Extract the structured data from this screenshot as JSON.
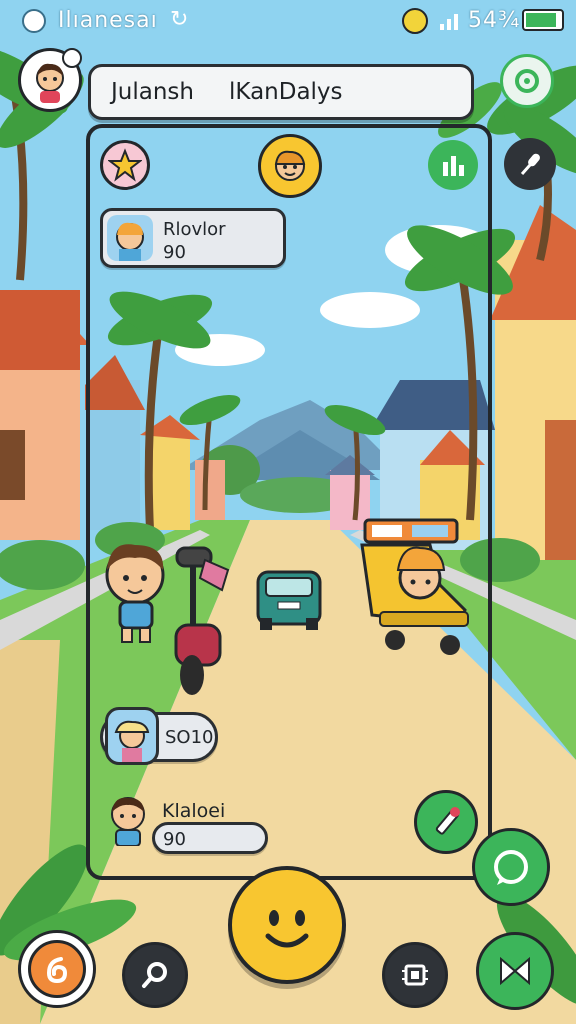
{
  "status_bar": {
    "carrier": "Ilıanesaı",
    "battery_text": "54¾"
  },
  "search_bar": {
    "left_text": "Julansh",
    "right_text": "lKanDalys"
  },
  "player_cards": [
    {
      "name": "Rlovlor",
      "value": "90"
    },
    {
      "name": "",
      "value": "SO10"
    },
    {
      "name": "Klaloei",
      "value": "90"
    }
  ],
  "icons": {
    "profile": "user-avatar-icon",
    "share": "share-icon",
    "stats": "bar-chart-icon",
    "mic": "microphone-icon",
    "star": "star-icon",
    "character": "character-face-icon",
    "edit": "pencil-icon",
    "chat": "chat-icon",
    "home": "swirl-icon",
    "search": "search-icon",
    "map": "map-icon",
    "emoji": "smiley-icon",
    "chip": "chip-icon"
  },
  "colors": {
    "sky": "#8fd3f0",
    "road": "#f2d9a0",
    "grass": "#7cc85a",
    "accent_green": "#3cb55a",
    "dark_button": "#2f3338",
    "smiley": "#f8c630"
  }
}
